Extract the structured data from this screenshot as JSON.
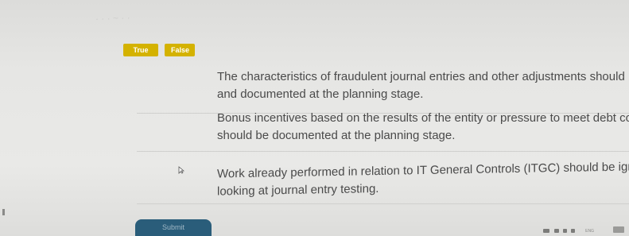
{
  "header": {
    "faded_text": "·  · · ~ ·   ·"
  },
  "answer_options": {
    "true_label": "True",
    "false_label": "False",
    "accent_color": "#d4b200"
  },
  "statements": [
    {
      "line1": "The characteristics of fraudulent journal entries and other adjustments should be discusse",
      "line2": "and documented at the planning stage."
    },
    {
      "line1": "Bonus incentives based on the results of the entity or pressure to meet debt covenants",
      "line2": "should be documented at the planning stage."
    },
    {
      "line1": "Work already performed in relation to IT General Controls (ITGC) should be ignored when",
      "line2": "looking at journal entry testing."
    }
  ],
  "footer": {
    "submit_label": "Submit",
    "submit_color": "#2a5d7a",
    "tray_text": "ENG"
  }
}
